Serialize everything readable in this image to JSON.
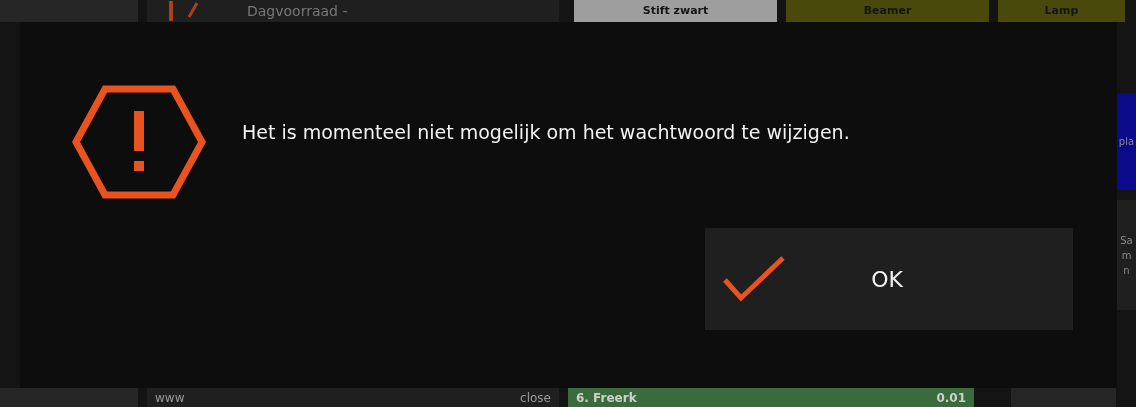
{
  "background": {
    "top_tiles": [
      {
        "kind": "plain",
        "color": "#262626"
      },
      {
        "kind": "icon",
        "color": "#1f1f1f",
        "label": "Dagvoorraad -"
      },
      {
        "kind": "label",
        "color": "#9e9e9e",
        "label": "Stift zwart"
      },
      {
        "kind": "label",
        "color": "#4a490c",
        "label": "Beamer"
      },
      {
        "kind": "label",
        "color": "#4a490c",
        "label": "Lamp"
      }
    ],
    "side_tiles": [
      {
        "color": "#0a0a8a",
        "lines": [
          "pla"
        ]
      },
      {
        "color": "#1f1f1f",
        "lines": [
          "Sa",
          "m",
          "n"
        ]
      }
    ],
    "bottom_tiles": [
      {
        "kind": "plain",
        "color": "#262626"
      },
      {
        "kind": "pair",
        "color": "#1f1f1f",
        "label": "www",
        "value": "close"
      },
      {
        "kind": "pair",
        "color": "#3a6b3c",
        "label": "6. Freerk",
        "value": "0.01"
      },
      {
        "kind": "plain",
        "color": "#262626"
      }
    ]
  },
  "dialog": {
    "message": "Het is momenteel niet mogelijk om het wachtwoord te wijzigen.",
    "button": "OK"
  }
}
